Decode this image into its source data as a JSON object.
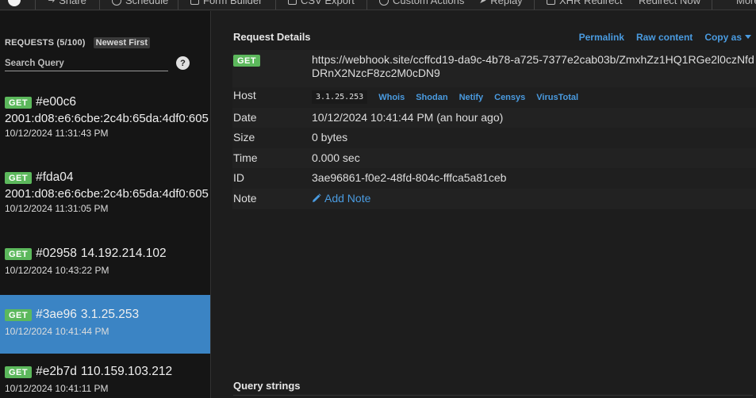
{
  "toolbar": {
    "items": [
      {
        "label": "Share",
        "icon": "share-icon"
      },
      {
        "label": "Schedule",
        "icon": "clock-icon"
      },
      {
        "label": "Form Builder",
        "icon": "form-icon"
      },
      {
        "label": "CSV Export",
        "icon": "file-icon"
      },
      {
        "label": "Custom Actions",
        "icon": "gear-icon"
      },
      {
        "label": "Replay",
        "icon": "replay-icon"
      },
      {
        "label": "XHR Redirect",
        "icon": "redirect-icon"
      },
      {
        "label": "Redirect Now",
        "icon": ""
      },
      {
        "label": "More",
        "icon": ""
      }
    ]
  },
  "sidebar": {
    "title": "REQUESTS (5/100)",
    "sort_label": "Newest First",
    "search_placeholder": "Search Query",
    "help_label": "?",
    "requests": [
      {
        "method": "GET",
        "id": "#e00c6",
        "ip": "2001:d08:e6:6cbe:2c4b:65da:4df0:605",
        "time": "10/12/2024 11:31:43 PM"
      },
      {
        "method": "GET",
        "id": "#fda04",
        "ip": "2001:d08:e6:6cbe:2c4b:65da:4df0:605",
        "time": "10/12/2024 11:31:05 PM"
      },
      {
        "method": "GET",
        "id": "#02958",
        "ip": "14.192.214.102",
        "time": "10/12/2024 10:43:22 PM"
      },
      {
        "method": "GET",
        "id": "#3ae96",
        "ip": "3.1.25.253",
        "time": "10/12/2024 10:41:44 PM"
      },
      {
        "method": "GET",
        "id": "#e2b7d",
        "ip": "110.159.103.212",
        "time": "10/12/2024 10:41:11 PM"
      }
    ]
  },
  "details": {
    "title": "Request Details",
    "links": {
      "permalink": "Permalink",
      "raw": "Raw content",
      "copy": "Copy as"
    },
    "method": "GET",
    "url": "https://webhook.site/ccffcd19-da9c-4b78-a725-7377e2cab03b/ZmxhZz1HQ1RGe2l0czNfdDRnX2NzcF8zc2M0cDN9",
    "host_label": "Host",
    "host_ip": "3.1.25.253",
    "host_links": [
      "Whois",
      "Shodan",
      "Netify",
      "Censys",
      "VirusTotal"
    ],
    "date_label": "Date",
    "date_value": "10/12/2024 10:41:44 PM (an hour ago)",
    "size_label": "Size",
    "size_value": "0 bytes",
    "time_label": "Time",
    "time_value": "0.000 sec",
    "id_label": "ID",
    "id_value": "3ae96861-f0e2-48fd-804c-fffca5a81ceb",
    "note_label": "Note",
    "note_action": "Add Note"
  },
  "query_strings": {
    "title": "Query strings"
  }
}
